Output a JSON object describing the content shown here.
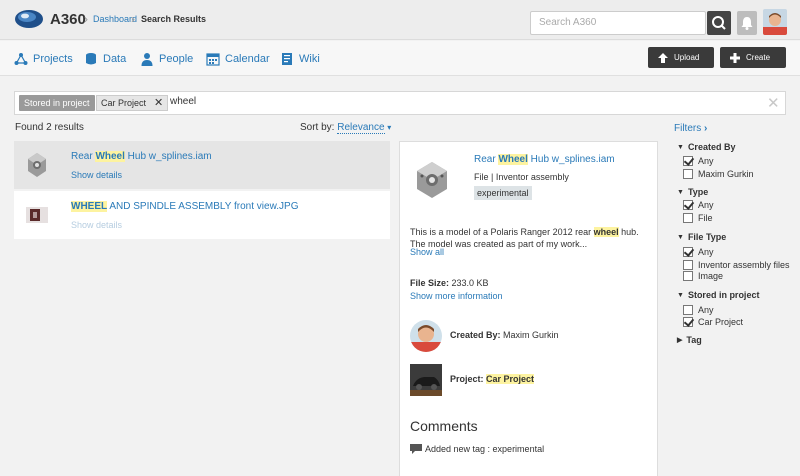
{
  "header": {
    "app_title": "A360",
    "breadcrumb_dashboard": "Dashboard",
    "breadcrumb_current": "Search Results",
    "search_placeholder": "Search A360"
  },
  "nav": {
    "items": [
      {
        "label": "Projects",
        "icon": "projects-icon"
      },
      {
        "label": "Data",
        "icon": "data-icon"
      },
      {
        "label": "People",
        "icon": "people-icon"
      },
      {
        "label": "Calendar",
        "icon": "calendar-icon"
      },
      {
        "label": "Wiki",
        "icon": "wiki-icon"
      }
    ],
    "upload_label": "Upload",
    "create_label": "Create"
  },
  "filterbar": {
    "scope_label": "Stored in project",
    "project_chip": "Car Project",
    "query": "wheel"
  },
  "results": {
    "found_label": "Found 2 results",
    "sort_label": "Sort by:",
    "sort_value": "Relevance",
    "items": [
      {
        "title_pre": "Rear ",
        "title_hl": "Wheel",
        "title_post": " Hub w_splines.iam",
        "details": "Show details",
        "selected": true
      },
      {
        "title_pre": "",
        "title_hl": "WHEEL",
        "title_post": " AND SPINDLE ASSEMBLY front view.JPG",
        "details": "Show details",
        "selected": false
      }
    ]
  },
  "detail": {
    "title_pre": "Rear ",
    "title_hl": "Wheel",
    "title_post": " Hub w_splines.iam",
    "meta": "File | Inventor assembly",
    "tag": "experimental",
    "desc_pre": "This is a model of a Polaris Ranger 2012 rear ",
    "desc_hl": "wheel",
    "desc_post": " hub. The model was created as part of my work...",
    "show_all": "Show all",
    "file_size_label": "File Size:",
    "file_size_value": "233.0 KB",
    "more_info": "Show more information",
    "created_by_label": "Created By:",
    "created_by_value": "Maxim Gurkin",
    "project_label": "Project:",
    "project_value": "Car Project",
    "comments_heading": "Comments",
    "comment_text": "Added new tag : experimental"
  },
  "filters": {
    "title": "Filters",
    "groups": [
      {
        "title": "Created By",
        "options": [
          {
            "label": "Any",
            "checked": true
          },
          {
            "label": "Maxim Gurkin",
            "checked": false
          }
        ]
      },
      {
        "title": "Type",
        "options": [
          {
            "label": "Any",
            "checked": true
          },
          {
            "label": "File",
            "checked": false
          }
        ]
      },
      {
        "title": "File Type",
        "options": [
          {
            "label": "Any",
            "checked": true
          },
          {
            "label": "Inventor assembly files",
            "checked": false
          },
          {
            "label": "Image",
            "checked": false
          }
        ]
      },
      {
        "title": "Stored in project",
        "options": [
          {
            "label": "Any",
            "checked": false
          },
          {
            "label": "Car Project",
            "checked": true
          }
        ]
      },
      {
        "title": "Tag",
        "options": []
      }
    ]
  },
  "colors": {
    "link": "#2a7ab8",
    "highlight": "#fdf3a0",
    "dark_button": "#3a3a3a"
  }
}
